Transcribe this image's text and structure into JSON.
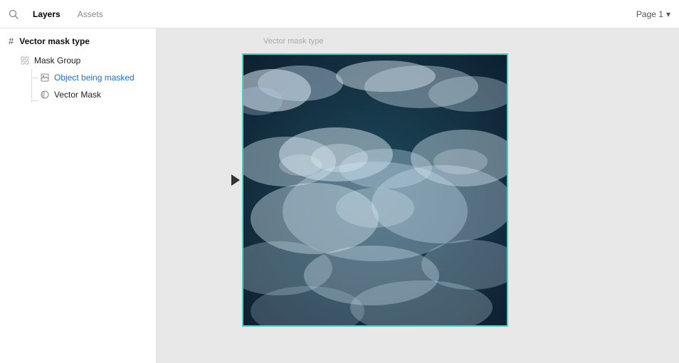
{
  "topbar": {
    "search_icon": "🔍",
    "layers_tab": "Layers",
    "assets_tab": "Assets",
    "page_label": "Page 1",
    "chevron": "▾"
  },
  "sidebar": {
    "frame_title": "Vector mask type",
    "hash_icon": "#",
    "layers": [
      {
        "id": "mask-group",
        "label": "Mask Group",
        "indent": 1,
        "icon_type": "grid"
      },
      {
        "id": "object-being-masked",
        "label": "Object being masked",
        "indent": 2,
        "icon_type": "image",
        "is_blue": true
      },
      {
        "id": "vector-mask",
        "label": "Vector Mask",
        "indent": 2,
        "icon_type": "circle"
      }
    ]
  },
  "canvas": {
    "frame_label": "Vector mask type"
  }
}
